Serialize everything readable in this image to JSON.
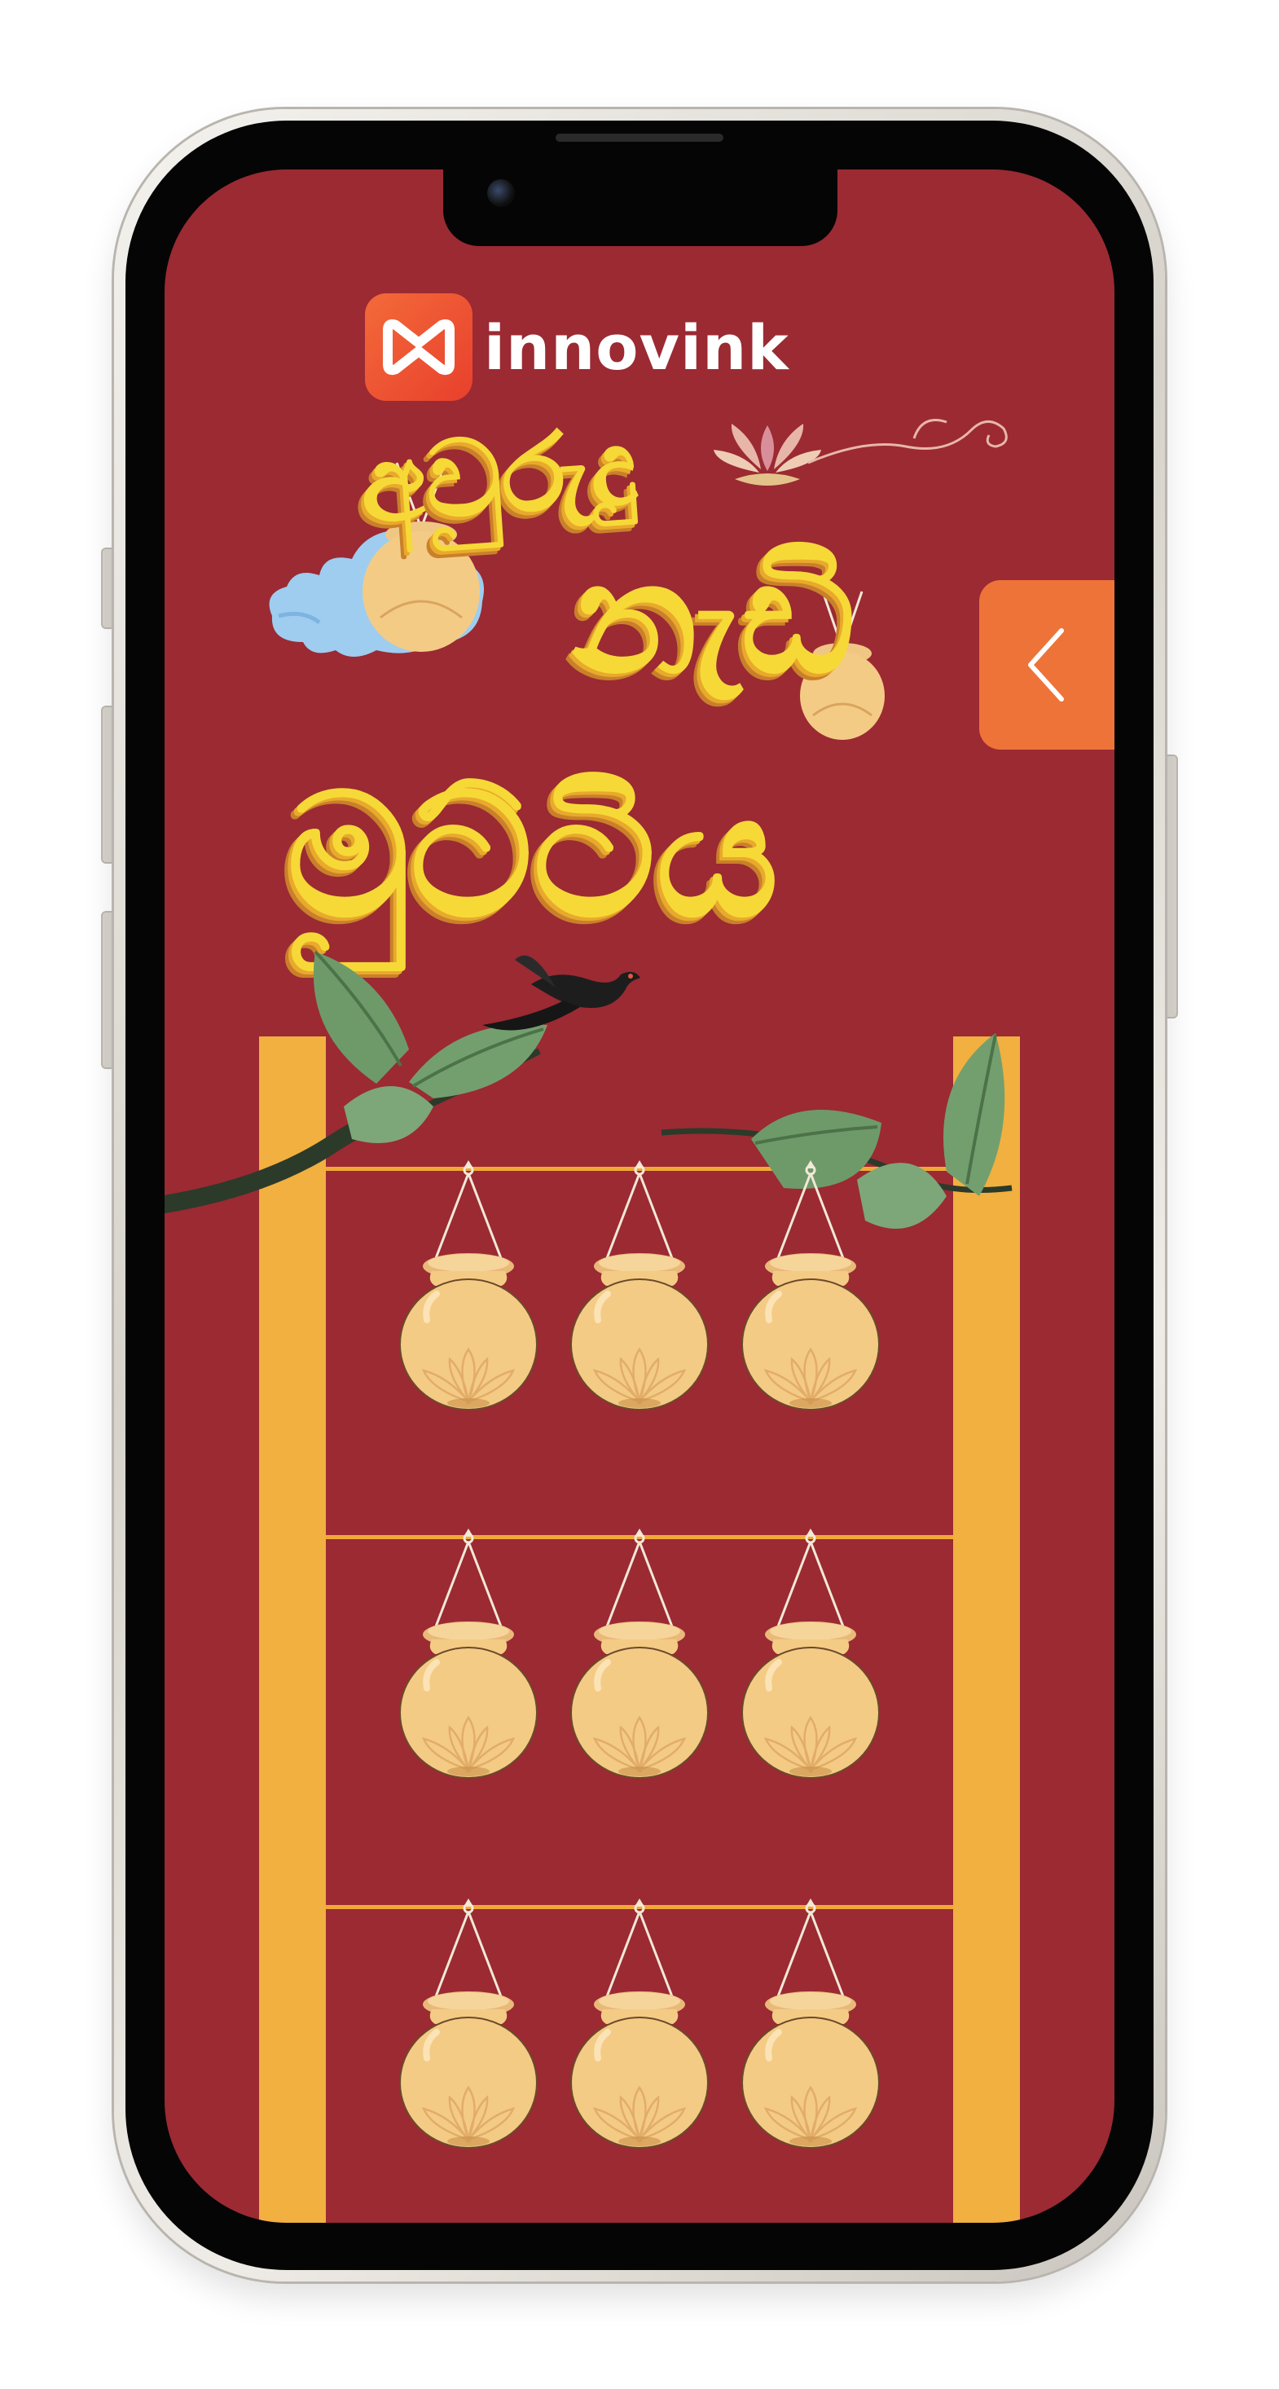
{
  "brand": {
    "name": "innovink",
    "logo_bg": "#ee5a34"
  },
  "title": {
    "line1": "අවුරුදු",
    "line2": "නැඩි",
    "line3": "මුට්ටිය"
  },
  "back_tab": {
    "icon": "chevron-left-icon",
    "color": "#ee7339"
  },
  "colors": {
    "background": "#9b2a33",
    "title_yellow": "#f6d937",
    "post": "#f1b03f",
    "pot": "#f4cb85"
  },
  "pot_grid": {
    "rows": 3,
    "columns": 3
  }
}
